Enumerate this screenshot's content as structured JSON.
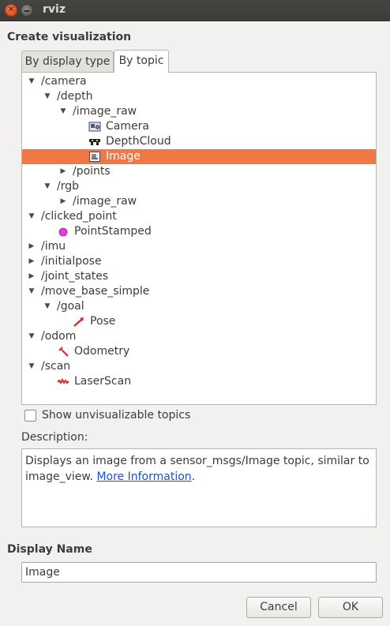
{
  "window": {
    "title": "rviz"
  },
  "heading": "Create visualization",
  "tabs": [
    {
      "label": "By display type",
      "active": false
    },
    {
      "label": "By topic",
      "active": true
    }
  ],
  "tree": [
    {
      "label": "/camera",
      "arrow": "▼"
    },
    {
      "label": "/depth",
      "arrow": "▼"
    },
    {
      "label": "/image_raw",
      "arrow": "▼"
    },
    {
      "label": "Camera",
      "icon": "camera-display-icon"
    },
    {
      "label": "DepthCloud",
      "icon": "depthcloud-display-icon"
    },
    {
      "label": "Image",
      "icon": "image-display-icon",
      "selected": true
    },
    {
      "label": "/points",
      "arrow": "▶"
    },
    {
      "label": "/rgb",
      "arrow": "▼"
    },
    {
      "label": "/image_raw",
      "arrow": "▶"
    },
    {
      "label": "/clicked_point",
      "arrow": "▼"
    },
    {
      "label": "PointStamped",
      "icon": "pointstamped-display-icon"
    },
    {
      "label": "/imu",
      "arrow": "▶"
    },
    {
      "label": "/initialpose",
      "arrow": "▶"
    },
    {
      "label": "/joint_states",
      "arrow": "▶"
    },
    {
      "label": "/move_base_simple",
      "arrow": "▼"
    },
    {
      "label": "/goal",
      "arrow": "▼"
    },
    {
      "label": "Pose",
      "icon": "pose-display-icon"
    },
    {
      "label": "/odom",
      "arrow": "▼"
    },
    {
      "label": "Odometry",
      "icon": "odometry-display-icon"
    },
    {
      "label": "/scan",
      "arrow": "▼"
    },
    {
      "label": "LaserScan",
      "icon": "laserscan-display-icon"
    }
  ],
  "show_unvisualizable": {
    "label": "Show unvisualizable topics",
    "checked": false
  },
  "description": {
    "label": "Description:",
    "text": "Displays an image from a sensor_msgs/Image topic, similar to image_view.",
    "link": "More Information",
    "trailing": "."
  },
  "display_name": {
    "label": "Display Name",
    "value": "Image"
  },
  "buttons": {
    "cancel": "Cancel",
    "ok": "OK"
  },
  "colors": {
    "selection": "#f07746",
    "link": "#1a4fd0",
    "close_button": "#e04e1b"
  }
}
